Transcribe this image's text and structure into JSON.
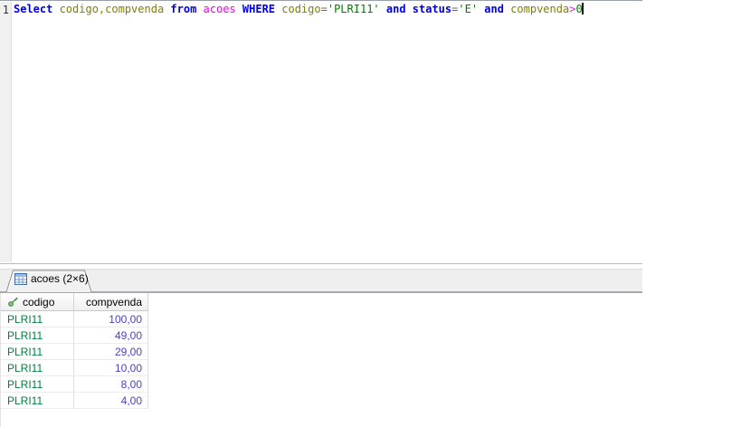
{
  "editor": {
    "line_number": "1",
    "tokens": [
      {
        "text": "Select ",
        "type": "keyword"
      },
      {
        "text": "codigo,compvenda ",
        "type": "identifier"
      },
      {
        "text": "from ",
        "type": "keyword"
      },
      {
        "text": "acoes ",
        "type": "table-name"
      },
      {
        "text": "WHERE ",
        "type": "keyword"
      },
      {
        "text": "codigo",
        "type": "identifier"
      },
      {
        "text": "=",
        "type": "operator"
      },
      {
        "text": "'PLRI11' ",
        "type": "string"
      },
      {
        "text": "and ",
        "type": "keyword"
      },
      {
        "text": "status",
        "type": "keyword"
      },
      {
        "text": "=",
        "type": "operator"
      },
      {
        "text": "'E' ",
        "type": "string"
      },
      {
        "text": "and ",
        "type": "keyword"
      },
      {
        "text": "compvenda",
        "type": "identifier"
      },
      {
        "text": ">",
        "type": "operator-magenta"
      },
      {
        "text": "0",
        "type": "number"
      }
    ],
    "full_query": "Select codigo,compvenda from acoes WHERE codigo='PLRI11' and status='E' and compvenda>0"
  },
  "results": {
    "tab": {
      "label": "acoes (2×6)",
      "icon": "table-grid-icon"
    },
    "columns": [
      {
        "name": "codigo",
        "key_icon": "primary-key-icon",
        "align": "left"
      },
      {
        "name": "compvenda",
        "align": "right"
      }
    ],
    "rows": [
      {
        "codigo": "PLRI11",
        "compvenda": "100,00"
      },
      {
        "codigo": "PLRI11",
        "compvenda": "49,00"
      },
      {
        "codigo": "PLRI11",
        "compvenda": "29,00"
      },
      {
        "codigo": "PLRI11",
        "compvenda": "10,00"
      },
      {
        "codigo": "PLRI11",
        "compvenda": "8,00"
      },
      {
        "codigo": "PLRI11",
        "compvenda": "4,00"
      }
    ]
  },
  "colors": {
    "keyword": "#0000e8",
    "identifier": "#808000",
    "table_name": "#ee00ee",
    "string": "#008000",
    "number": "#008000",
    "operator": "#666666",
    "operator_magenta": "#e020e0",
    "grid_text_green": "#008040",
    "grid_number_blue": "#4840cc"
  }
}
